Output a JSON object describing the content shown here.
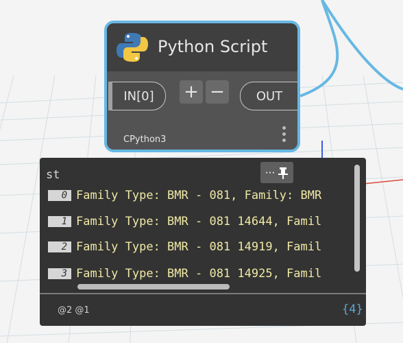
{
  "node": {
    "title": "Python Script",
    "engine": "CPython3",
    "input_port": "IN[0]",
    "output_port": "OUT",
    "add_label": "+",
    "remove_label": "−",
    "icon": "python-logo"
  },
  "preview": {
    "title": "st",
    "more_label": "···",
    "pin_icon": "pushpin-icon",
    "items": [
      {
        "index": "0",
        "value": "Family Type: BMR - 081, Family: BMR"
      },
      {
        "index": "1",
        "value": "Family Type: BMR - 081 14644, Famil"
      },
      {
        "index": "2",
        "value": "Family Type: BMR - 081 14919, Famil"
      },
      {
        "index": "3",
        "value": "Family Type: BMR - 081 14925, Famil"
      }
    ],
    "levels": "@2 @1",
    "count_open": "{",
    "count": "4",
    "count_close": "}"
  },
  "colors": {
    "node_border": "#67b8e3",
    "wire": "#67b8e3",
    "value_text": "#f0e9a6",
    "panel": "#333333"
  }
}
